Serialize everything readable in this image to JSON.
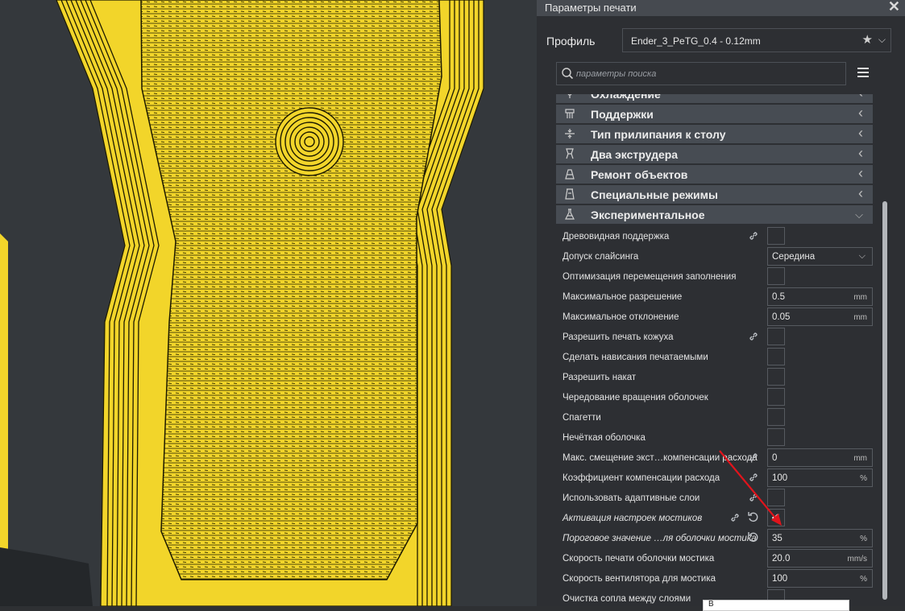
{
  "panel": {
    "title": "Параметры печати",
    "close_glyph": "✕",
    "profile_label": "Профиль",
    "profile_value": "Ender_3_PeTG_0.4 - 0.12mm",
    "search_placeholder": "параметры поиска"
  },
  "categories": [
    {
      "label": "Охлаждение",
      "icon": "fan-icon",
      "state": "collapsed"
    },
    {
      "label": "Поддержки",
      "icon": "support-icon",
      "state": "collapsed"
    },
    {
      "label": "Тип прилипания к столу",
      "icon": "adhesion-icon",
      "state": "collapsed"
    },
    {
      "label": "Два экструдера",
      "icon": "dual-extruder-icon",
      "state": "collapsed"
    },
    {
      "label": "Ремонт объектов",
      "icon": "mesh-fix-icon",
      "state": "collapsed"
    },
    {
      "label": "Специальные режимы",
      "icon": "special-modes-icon",
      "state": "collapsed"
    },
    {
      "label": "Экспериментальное",
      "icon": "flask-icon",
      "state": "expanded"
    }
  ],
  "settings": [
    {
      "label": "Древовидная поддержка",
      "type": "checkbox",
      "checked": false,
      "link": true
    },
    {
      "label": "Допуск слайсинга",
      "type": "dropdown",
      "value": "Середина"
    },
    {
      "label": "Оптимизация перемещения заполнения",
      "type": "checkbox",
      "checked": false
    },
    {
      "label": "Максимальное разрешение",
      "type": "number",
      "value": "0.5",
      "unit": "mm"
    },
    {
      "label": "Максимальное отклонение",
      "type": "number",
      "value": "0.05",
      "unit": "mm"
    },
    {
      "label": "Разрешить печать кожуха",
      "type": "checkbox",
      "checked": false,
      "link": true
    },
    {
      "label": "Сделать нависания печатаемыми",
      "type": "checkbox",
      "checked": false
    },
    {
      "label": "Разрешить накат",
      "type": "checkbox",
      "checked": false
    },
    {
      "label": "Чередование вращения оболочек",
      "type": "checkbox",
      "checked": false
    },
    {
      "label": "Спагетти",
      "type": "checkbox",
      "checked": false
    },
    {
      "label": "Нечёткая оболочка",
      "type": "checkbox",
      "checked": false
    },
    {
      "label": "Макс. смещение экст…компенсации расхода",
      "type": "number",
      "value": "0",
      "unit": "mm",
      "link": true
    },
    {
      "label": "Коэффициент компенсации расхода",
      "type": "number",
      "value": "100",
      "unit": "%",
      "link": true
    },
    {
      "label": "Использовать адаптивные слои",
      "type": "checkbox",
      "checked": false,
      "link": true
    },
    {
      "label": "Активация настроек мостиков",
      "type": "checkbox",
      "checked": true,
      "link": true,
      "reset": true,
      "italic": true
    },
    {
      "label": "Пороговое значение …ля оболочки мостика",
      "type": "number",
      "value": "35",
      "unit": "%",
      "reset": true,
      "italic": true
    },
    {
      "label": "Скорость печати оболочки мостика",
      "type": "number",
      "value": "20.0",
      "unit": "mm/s"
    },
    {
      "label": "Скорость вентилятора для мостика",
      "type": "number",
      "value": "100",
      "unit": "%"
    },
    {
      "label": "Очистка сопла между слоями",
      "type": "checkbox",
      "checked": false
    }
  ],
  "tooltip": {
    "text": "В"
  },
  "colors": {
    "filament": "#f2d52a",
    "viewport_bg": "#34383c",
    "panel_bg": "#2d2f33",
    "category_bg": "#474c53",
    "annotation_arrow": "#e0141c"
  }
}
